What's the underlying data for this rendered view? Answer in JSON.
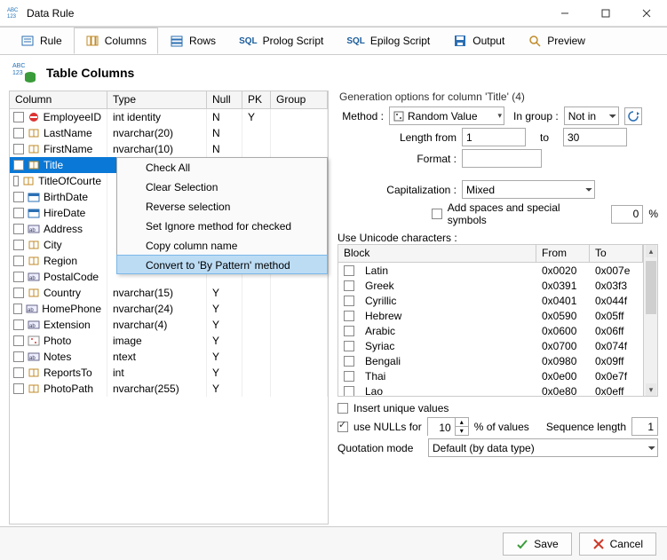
{
  "window": {
    "title": "Data Rule"
  },
  "tabs": [
    {
      "label": "Rule"
    },
    {
      "label": "Columns"
    },
    {
      "label": "Rows"
    },
    {
      "label": "Prolog Script",
      "prefix": "SQL"
    },
    {
      "label": "Epilog Script",
      "prefix": "SQL"
    },
    {
      "label": "Output"
    },
    {
      "label": "Preview"
    }
  ],
  "section": {
    "title": "Table Columns"
  },
  "grid": {
    "headers": {
      "column": "Column",
      "type": "Type",
      "null": "Null",
      "pk": "PK",
      "group": "Group"
    },
    "rows": [
      {
        "name": "EmployeeID",
        "type": "int identity",
        "null": "N",
        "pk": "Y",
        "icon": "no"
      },
      {
        "name": "LastName",
        "type": "nvarchar(20)",
        "null": "N",
        "pk": "",
        "icon": "col"
      },
      {
        "name": "FirstName",
        "type": "nvarchar(10)",
        "null": "N",
        "pk": "",
        "icon": "col"
      },
      {
        "name": "Title",
        "type": "",
        "null": "",
        "pk": "",
        "icon": "col",
        "selected": true
      },
      {
        "name": "TitleOfCourte",
        "type": "",
        "null": "",
        "pk": "",
        "icon": "col"
      },
      {
        "name": "BirthDate",
        "type": "",
        "null": "",
        "pk": "",
        "icon": "date"
      },
      {
        "name": "HireDate",
        "type": "",
        "null": "",
        "pk": "",
        "icon": "date"
      },
      {
        "name": "Address",
        "type": "",
        "null": "",
        "pk": "",
        "icon": "txt"
      },
      {
        "name": "City",
        "type": "",
        "null": "",
        "pk": "",
        "icon": "col"
      },
      {
        "name": "Region",
        "type": "",
        "null": "",
        "pk": "",
        "icon": "col"
      },
      {
        "name": "PostalCode",
        "type": "",
        "null": "",
        "pk": "",
        "icon": "txt"
      },
      {
        "name": "Country",
        "type": "nvarchar(15)",
        "null": "Y",
        "pk": "",
        "icon": "col"
      },
      {
        "name": "HomePhone",
        "type": "nvarchar(24)",
        "null": "Y",
        "pk": "",
        "icon": "txt"
      },
      {
        "name": "Extension",
        "type": "nvarchar(4)",
        "null": "Y",
        "pk": "",
        "icon": "txt"
      },
      {
        "name": "Photo",
        "type": "image",
        "null": "Y",
        "pk": "",
        "icon": "img"
      },
      {
        "name": "Notes",
        "type": "ntext",
        "null": "Y",
        "pk": "",
        "icon": "txt"
      },
      {
        "name": "ReportsTo",
        "type": "int",
        "null": "Y",
        "pk": "",
        "icon": "col"
      },
      {
        "name": "PhotoPath",
        "type": "nvarchar(255)",
        "null": "Y",
        "pk": "",
        "icon": "col"
      }
    ]
  },
  "ctx": {
    "items": [
      "Check All",
      "Clear Selection",
      "Reverse selection",
      "Set Ignore method for checked",
      "Copy column name",
      "Convert to 'By Pattern' method"
    ]
  },
  "gen": {
    "header": "Generation options for column 'Title' (4)",
    "method_label": "Method :",
    "method_value": "Random Value",
    "ingroup_label": "In group :",
    "ingroup_value": "Not in",
    "length_from_label": "Length from",
    "length_from": "1",
    "length_to_label": "to",
    "length_to": "30",
    "format_label": "Format :",
    "format_value": "",
    "cap_label": "Capitalization :",
    "cap_value": "Mixed",
    "spaces_label": "Add spaces and special symbols",
    "spaces_pct": "0",
    "pct_suffix": "%",
    "unicode_label": "Use Unicode characters :",
    "uni_headers": {
      "block": "Block",
      "from": "From",
      "to": "To"
    },
    "uni_rows": [
      {
        "block": "Latin",
        "from": "0x0020",
        "to": "0x007e"
      },
      {
        "block": "Greek",
        "from": "0x0391",
        "to": "0x03f3"
      },
      {
        "block": "Cyrillic",
        "from": "0x0401",
        "to": "0x044f"
      },
      {
        "block": "Hebrew",
        "from": "0x0590",
        "to": "0x05ff"
      },
      {
        "block": "Arabic",
        "from": "0x0600",
        "to": "0x06ff"
      },
      {
        "block": "Syriac",
        "from": "0x0700",
        "to": "0x074f"
      },
      {
        "block": "Bengali",
        "from": "0x0980",
        "to": "0x09ff"
      },
      {
        "block": "Thai",
        "from": "0x0e00",
        "to": "0x0e7f"
      },
      {
        "block": "Lao",
        "from": "0x0e80",
        "to": "0x0eff"
      }
    ],
    "insert_unique": "Insert unique values",
    "use_nulls": "use NULLs for",
    "nulls_pct": "10",
    "of_values": "% of values",
    "seq_label": "Sequence length",
    "seq_value": "1",
    "quot_label": "Quotation mode",
    "quot_value": "Default (by data type)"
  },
  "footer": {
    "save": "Save",
    "cancel": "Cancel"
  }
}
